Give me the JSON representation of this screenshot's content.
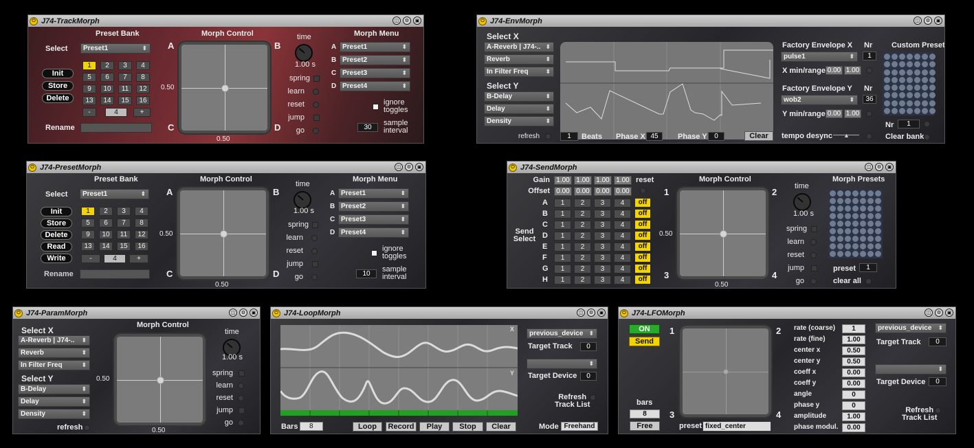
{
  "track": {
    "title": "J74-TrackMorph",
    "preset_bank": "Preset Bank",
    "morph_control": "Morph Control",
    "morph_menu": "Morph Menu",
    "select": "Select",
    "select_value": "Preset1",
    "init": "Init",
    "store": "Store",
    "delete": "Delete",
    "rename": "Rename",
    "nums": [
      "1",
      "2",
      "3",
      "4",
      "5",
      "6",
      "7",
      "8",
      "9",
      "10",
      "11",
      "12",
      "13",
      "14",
      "15",
      "16"
    ],
    "minus": "-",
    "page": "4",
    "plus": "+",
    "corner_a": "A",
    "corner_b": "B",
    "corner_c": "C",
    "corner_d": "D",
    "x_val": "0.50",
    "y_val": "0.50",
    "time": "time",
    "time_val": "1.00 s",
    "spring": "spring",
    "learn": "learn",
    "reset": "reset",
    "jump": "jump",
    "go": "go",
    "menu_letters": [
      "A",
      "B",
      "C",
      "D"
    ],
    "menu_items": [
      "Preset1",
      "Preset2",
      "Preset3",
      "Preset4"
    ],
    "ignore": "ignore",
    "toggles": "toggles",
    "interval_val": "30",
    "sample": "sample",
    "interval": "interval"
  },
  "preset": {
    "title": "J74-PresetMorph",
    "preset_bank": "Preset Bank",
    "morph_control": "Morph Control",
    "morph_menu": "Morph Menu",
    "select": "Select",
    "select_value": "Preset1",
    "init": "Init",
    "store": "Store",
    "delete": "Delete",
    "read": "Read",
    "write": "Write",
    "rename": "Rename",
    "nums": [
      "1",
      "2",
      "3",
      "4",
      "5",
      "6",
      "7",
      "8",
      "9",
      "10",
      "11",
      "12",
      "13",
      "14",
      "15",
      "16"
    ],
    "minus": "-",
    "page": "4",
    "plus": "+",
    "corner_a": "A",
    "corner_b": "B",
    "corner_c": "C",
    "corner_d": "D",
    "x_val": "0.50",
    "y_val": "0.50",
    "time": "time",
    "time_val": "1.00 s",
    "spring": "spring",
    "learn": "learn",
    "reset": "reset",
    "jump": "jump",
    "go": "go",
    "menu_letters": [
      "A",
      "B",
      "C",
      "D"
    ],
    "menu_items": [
      "Preset1",
      "Preset2",
      "Preset3",
      "Preset4"
    ],
    "ignore": "ignore",
    "toggles": "toggles",
    "interval_val": "10",
    "sample": "sample",
    "interval": "interval"
  },
  "env": {
    "title": "J74-EnvMorph",
    "select_x": "Select X",
    "x_menus": [
      "A-Reverb | J74-..",
      "Reverb",
      "In Filter Freq"
    ],
    "select_y": "Select Y",
    "y_menus": [
      "B-Delay",
      "Delay",
      "Density"
    ],
    "refresh": "refresh",
    "beats_val": "1",
    "beats": "Beats",
    "phase_x": "Phase X",
    "phase_x_val": "45",
    "phase_y": "Phase Y",
    "phase_y_val": "0",
    "clear": "Clear",
    "factory_x": "Factory Envelope X",
    "nr": "Nr",
    "factory_x_val": "pulse1",
    "factory_x_nr": "1",
    "x_minrange": "X min/range",
    "x_min": "0.00",
    "x_range": "1.00",
    "factory_y": "Factory Envelope Y",
    "factory_y_val": "wob2",
    "factory_y_nr": "36",
    "y_minrange": "Y min/range",
    "y_min": "0.00",
    "y_range": "1.00",
    "tempo_desync": "tempo desync",
    "custom_presets": "Custom Presets",
    "nr_val": "1",
    "clear_bank": "Clear bank"
  },
  "send": {
    "title": "J74-SendMorph",
    "gain": "Gain",
    "gain_vals": [
      "1.00",
      "1.00",
      "1.00",
      "1.00"
    ],
    "reset": "reset",
    "offset": "Offset",
    "offset_vals": [
      "0.00",
      "0.00",
      "0.00",
      "0.00"
    ],
    "rows": [
      "A",
      "B",
      "C",
      "D",
      "E",
      "F",
      "G",
      "H"
    ],
    "cols": [
      "1",
      "2",
      "3",
      "4"
    ],
    "off": "off",
    "send": "Send",
    "select": "Select",
    "morph_control": "Morph Control",
    "c1": "1",
    "c2": "2",
    "c3": "3",
    "c4": "4",
    "x_val": "0.50",
    "y_val": "0.50",
    "time": "time",
    "time_val": "1.00 s",
    "spring": "spring",
    "learn": "learn",
    "resetl": "reset",
    "jump": "jump",
    "go": "go",
    "morph_presets": "Morph Presets",
    "preset": "preset",
    "preset_val": "1",
    "clear_all": "clear all"
  },
  "param": {
    "title": "J74-ParamMorph",
    "select_x": "Select X",
    "x_menus": [
      "A-Reverb | J74-..",
      "Reverb",
      "In Filter Freq"
    ],
    "select_y": "Select Y",
    "y_menus": [
      "B-Delay",
      "Delay",
      "Density"
    ],
    "refresh": "refresh",
    "morph_control": "Morph Control",
    "x_val": "0.50",
    "y_val": "0.50",
    "time": "time",
    "time_val": "1.00 s",
    "spring": "spring",
    "learn": "learn",
    "reset": "reset",
    "jump": "jump",
    "go": "go"
  },
  "loop": {
    "title": "J74-LoopMorph",
    "lx": "X",
    "ly": "Y",
    "bars": "Bars",
    "bars_val": "8",
    "loop": "Loop",
    "record": "Record",
    "play": "Play",
    "stop": "Stop",
    "clear": "Clear",
    "device1": "previous_device",
    "target_track": "Target Track",
    "target_track_val": "0",
    "target_device": "Target Device",
    "target_device_val": "0",
    "refresh": "Refresh",
    "track_list": "Track List",
    "mode": "Mode",
    "mode_val": "Freehand"
  },
  "lfo": {
    "title": "J74-LFOMorph",
    "on": "ON",
    "send": "Send",
    "c1": "1",
    "c2": "2",
    "c3": "3",
    "c4": "4",
    "bars": "bars",
    "bars_val": "8",
    "free": "Free",
    "preset": "preset",
    "preset_val": "fixed_center",
    "params": [
      [
        "rate (coarse)",
        "1"
      ],
      [
        "rate (fine)",
        "1.00"
      ],
      [
        "center x",
        "0.50"
      ],
      [
        "center y",
        "0.50"
      ],
      [
        "coeff x",
        "0.00"
      ],
      [
        "coeff y",
        "0.00"
      ],
      [
        "angle",
        "0"
      ],
      [
        "phase y",
        "0"
      ],
      [
        "amplitude",
        "1.00"
      ],
      [
        "phase modul.",
        "0.00"
      ]
    ],
    "device1": "previous_device",
    "target_track": "Target Track",
    "target_track_val": "0",
    "target_device": "Target Device",
    "target_device_val": "0",
    "refresh": "Refresh",
    "track_list": "Track List"
  },
  "icons": {
    "power": "power-icon",
    "titlebtns": [
      "collapse-icon",
      "settings-icon",
      "save-icon"
    ]
  }
}
